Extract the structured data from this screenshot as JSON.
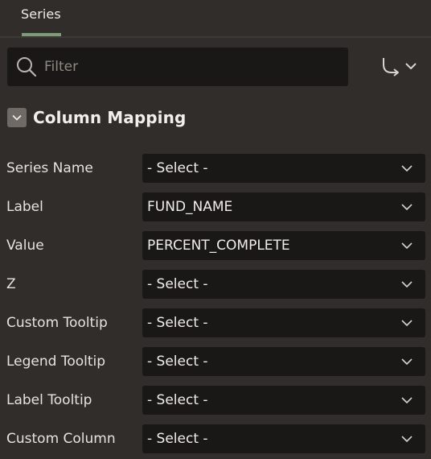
{
  "tabs": [
    {
      "label": "Series",
      "active": true
    }
  ],
  "filter": {
    "placeholder": "Filter",
    "value": ""
  },
  "goto_menu": {
    "icon": "goto-arrow-icon"
  },
  "section": {
    "title": "Column Mapping",
    "expanded": true
  },
  "fields": [
    {
      "label": "Series Name",
      "value": "- Select -"
    },
    {
      "label": "Label",
      "value": "FUND_NAME"
    },
    {
      "label": "Value",
      "value": "PERCENT_COMPLETE"
    },
    {
      "label": "Z",
      "value": "- Select -"
    },
    {
      "label": "Custom Tooltip",
      "value": "- Select -"
    },
    {
      "label": "Legend Tooltip",
      "value": "- Select -"
    },
    {
      "label": "Label Tooltip",
      "value": "- Select -"
    },
    {
      "label": "Custom Column",
      "value": "- Select -"
    }
  ],
  "colors": {
    "background": "#312d2a",
    "field_background": "#1a1816",
    "tab_accent": "#7c9b78",
    "toggle_background": "#6f6a65",
    "text": "#e6e3df"
  }
}
